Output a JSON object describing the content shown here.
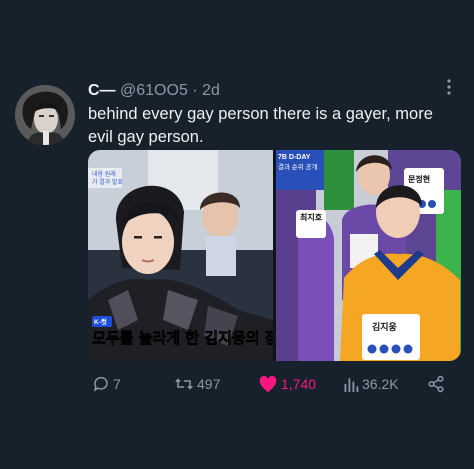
{
  "tweet": {
    "author_name": "C—",
    "handle": "@61OO5",
    "separator": "·",
    "time": "2d",
    "more_icon": "more-dots-icon",
    "text": "behind every gay person there is a gayer, more evil gay person."
  },
  "media": {
    "left_panel": {
      "corner_label_1": "내용 원래",
      "corner_label_2": "가 결과 발표",
      "caption_tag": "K-컷",
      "caption_prefix": "모두를 놀라게 한 ",
      "caption_highlight": "김지웅의 점"
    },
    "right_panel": {
      "banner_line_1": "7B D-DAY",
      "banner_line_2": "결과 순위 공개",
      "name_tags": [
        "최지호",
        "문정현",
        "김지웅"
      ]
    }
  },
  "actions": {
    "replies": "7",
    "retweets": "497",
    "likes": "1,740",
    "views": "36.2K"
  },
  "colors": {
    "background": "#16212b",
    "like_accent": "#f91880",
    "muted": "#8b98a5"
  }
}
